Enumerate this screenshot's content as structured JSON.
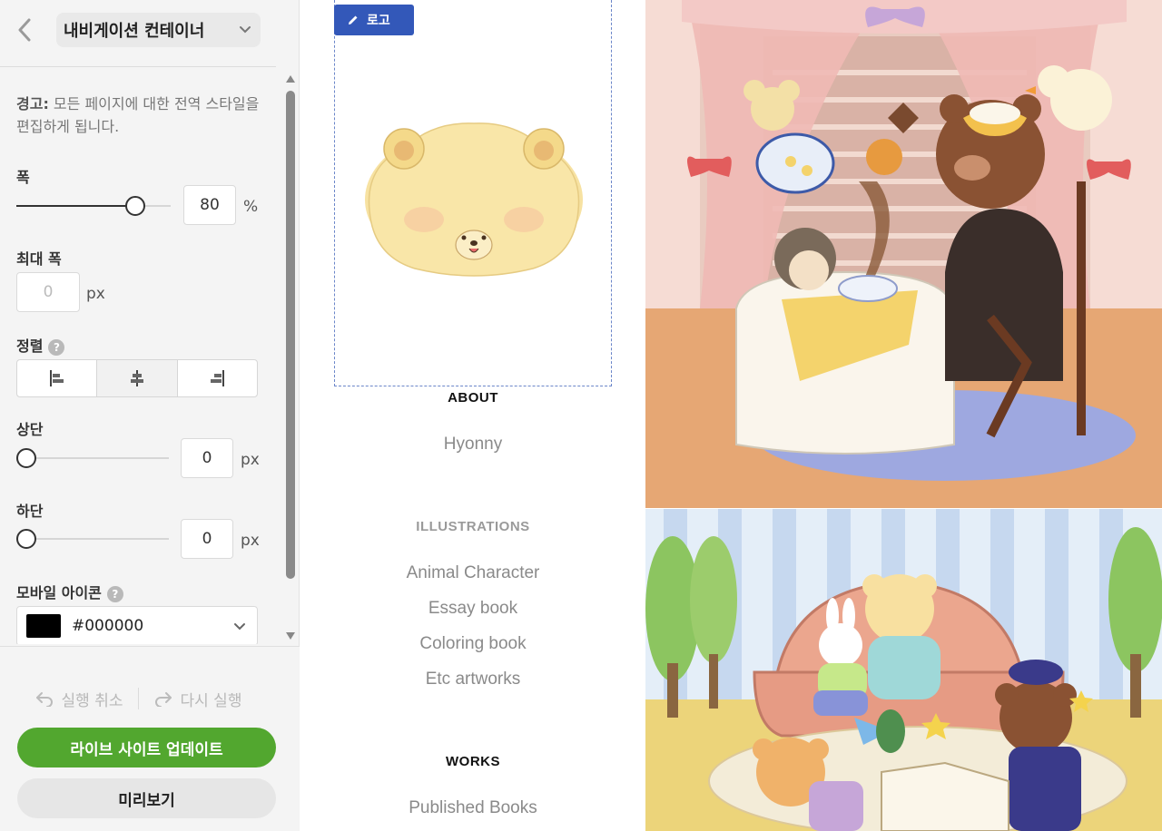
{
  "sidebar": {
    "container_select": {
      "label": "내비게이션 컨테이너"
    },
    "warning": {
      "prefix": "경고:",
      "text": " 모든 페이지에 대한 전역 스타일을 편집하게 됩니다."
    },
    "width": {
      "label": "폭",
      "value": "80",
      "unit": "%",
      "slider_fraction": 0.76
    },
    "max_width": {
      "label": "최대 폭",
      "placeholder": "0",
      "unit": "px"
    },
    "alignment": {
      "label": "정렬",
      "help": "?",
      "options": [
        "left",
        "center",
        "right"
      ],
      "selected": "center"
    },
    "top": {
      "label": "상단",
      "value": "0",
      "unit": "px",
      "slider_fraction": 0
    },
    "bottom": {
      "label": "하단",
      "value": "0",
      "unit": "px",
      "slider_fraction": 0
    },
    "mobile_icon": {
      "label": "모바일 아이콘",
      "help": "?",
      "color_value": "#000000",
      "color": "#000000"
    },
    "undo_label": "실행 취소",
    "redo_label": "다시 실행",
    "update_label": "라이브 사이트 업데이트",
    "preview_label": "미리보기"
  },
  "canvas": {
    "logo_tag_label": "로고",
    "nav": {
      "about_heading": "ABOUT",
      "about_links": [
        "Hyonny"
      ],
      "illustrations_heading": "ILLUSTRATIONS",
      "illustrations_links": [
        "Animal Character",
        "Essay book",
        "Coloring book",
        "Etc artworks"
      ],
      "works_heading": "WORKS",
      "works_links": [
        "Published Books"
      ]
    }
  },
  "colors": {
    "accent_green": "#52a72f",
    "logo_tag_blue": "#3358b9",
    "selection_dashed": "#6b86c9"
  }
}
